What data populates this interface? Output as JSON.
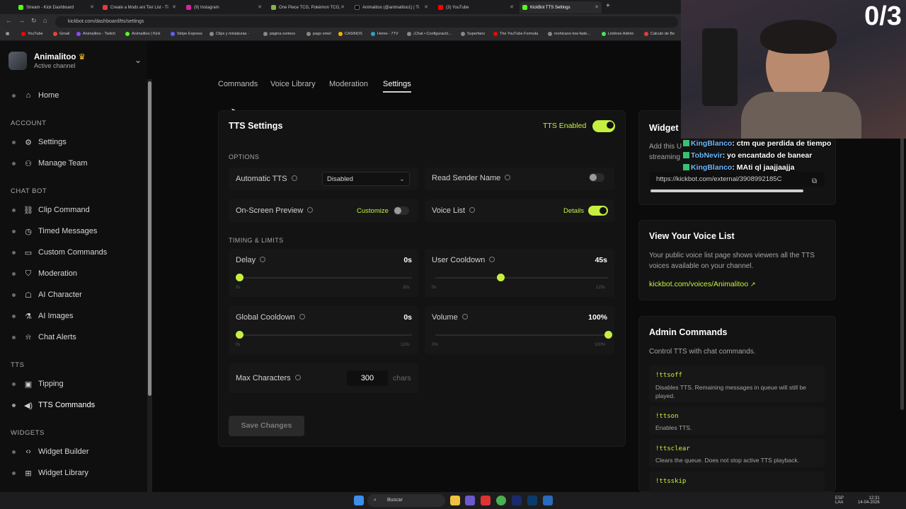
{
  "browser": {
    "tabs": [
      {
        "label": "Stream - Kick Dashboard",
        "color": "#53fc18"
      },
      {
        "label": "Create a Mods ani Tier List - Ti",
        "color": "#e63b3b"
      },
      {
        "label": "(9) Instagram",
        "color": "#d6249f"
      },
      {
        "label": "One Piece TCG, Pokémon TCG,",
        "color": "#8ab34a"
      },
      {
        "label": "Animalitoo (@animalitoo1) | Ti",
        "color": "#111111"
      },
      {
        "label": "(3) YouTube",
        "color": "#ff0000"
      },
      {
        "label": "KickBot TTS Settings",
        "color": "#53fc18"
      }
    ],
    "new_tab": "+",
    "url": "kickbot.com/dashboard/tts/settings",
    "bookmarks": [
      "YouTube",
      "Gmail",
      "Animalitoo - Twitch",
      "Animalitoo | Kick",
      "Stripe Express",
      "Clips y miniaturas -",
      "página sorteos",
      "pago emel",
      "CASINOS",
      "Home - 7TV",
      "¡Chat • Configuració...",
      "Superfans",
      "The YouTube Formula",
      "mohicano-low-fade...",
      "Linktree Admin",
      "Calculo de Bo"
    ]
  },
  "sidebar": {
    "channel_name": "Animalitoo",
    "channel_status": "Active channel",
    "home": "Home",
    "sections": [
      {
        "title": "ACCOUNT",
        "items": [
          {
            "label": "Settings",
            "icon": "gear-icon"
          },
          {
            "label": "Manage Team",
            "icon": "team-icon"
          }
        ]
      },
      {
        "title": "CHAT BOT",
        "items": [
          {
            "label": "Clip Command",
            "icon": "link-icon"
          },
          {
            "label": "Timed Messages",
            "icon": "clock-icon"
          },
          {
            "label": "Custom Commands",
            "icon": "terminal-icon"
          },
          {
            "label": "Moderation",
            "icon": "shield-icon"
          },
          {
            "label": "AI Character",
            "icon": "robot-icon"
          },
          {
            "label": "AI Images",
            "icon": "flask-icon"
          },
          {
            "label": "Chat Alerts",
            "icon": "bell-icon"
          }
        ]
      },
      {
        "title": "TTS",
        "items": [
          {
            "label": "Tipping",
            "icon": "wallet-icon"
          },
          {
            "label": "TTS Commands",
            "icon": "speaker-icon"
          }
        ]
      },
      {
        "title": "WIDGETS",
        "items": [
          {
            "label": "Widget Builder",
            "icon": "code-icon"
          },
          {
            "label": "Widget Library",
            "icon": "grid-icon"
          }
        ]
      }
    ]
  },
  "tabs": [
    "Commands",
    "Voice Library",
    "Moderation",
    "Settings"
  ],
  "tts": {
    "title": "TTS Settings",
    "enabled_label": "TTS Enabled",
    "enabled": true,
    "options_head": "OPTIONS",
    "automatic_tts": "Automatic TTS",
    "automatic_tts_value": "Disabled",
    "read_sender_name": "Read Sender Name",
    "on_screen_preview": "On-Screen Preview",
    "customize": "Customize",
    "voice_list": "Voice List",
    "details": "Details",
    "timing_head": "TIMING & LIMITS",
    "delay": {
      "label": "Delay",
      "value": "0s",
      "min": "0s",
      "max": "30s",
      "fraction": 0.0
    },
    "user_cooldown": {
      "label": "User Cooldown",
      "value": "45s",
      "min": "0s",
      "max": "120s",
      "fraction": 0.375
    },
    "global_cooldown": {
      "label": "Global Cooldown",
      "value": "0s",
      "min": "0s",
      "max": "120s",
      "fraction": 0.0
    },
    "volume": {
      "label": "Volume",
      "value": "100%",
      "min": "0%",
      "max": "100%",
      "fraction": 1.0
    },
    "max_chars_label": "Max Characters",
    "max_chars_value": "300",
    "max_chars_unit": "chars",
    "save": "Save Changes"
  },
  "widget": {
    "title": "Widget",
    "desc_partial": "Add this U",
    "desc_partial2": "streaming",
    "url": "https://kickbot.com/external/3908992185C"
  },
  "voicelist": {
    "title": "View Your Voice List",
    "desc": "Your public voice list page shows viewers all the TTS voices available on your channel.",
    "link": "kickbot.com/voices/Animalitoo"
  },
  "admin": {
    "title": "Admin Commands",
    "desc": "Control TTS with chat commands.",
    "commands": [
      {
        "cmd": "!ttsoff",
        "desc": "Disables TTS. Remaining messages in queue will still be played."
      },
      {
        "cmd": "!ttson",
        "desc": "Enables TTS."
      },
      {
        "cmd": "!ttsclear",
        "desc": "Clears the queue. Does not stop active TTS playback."
      },
      {
        "cmd": "!ttsskip",
        "desc": ""
      }
    ]
  },
  "overlay": {
    "counter": "0/3",
    "chat": [
      {
        "user": "KingBlanco",
        "msg": ": ctm que perdida de tiempo"
      },
      {
        "user": "TobNevir",
        "msg": ": yo encantado de banear"
      },
      {
        "user": "KingBlanco",
        "msg": ": MAti ql jaajjaajja"
      }
    ]
  },
  "taskbar": {
    "search": "Buscar",
    "lang": "ESP",
    "lang2": "LAA",
    "time": "12:31",
    "date": "14-04-2026"
  }
}
